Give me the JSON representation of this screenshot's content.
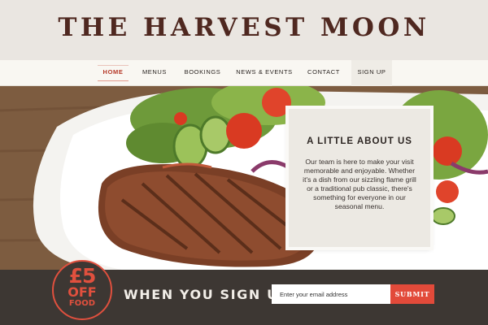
{
  "brand": {
    "name": "THE HARVEST MOON"
  },
  "nav": {
    "items": [
      {
        "label": "HOME",
        "active": true
      },
      {
        "label": "MENUS"
      },
      {
        "label": "BOOKINGS"
      },
      {
        "label": "NEWS & EVENTS"
      },
      {
        "label": "CONTACT"
      },
      {
        "label": "SIGN UP"
      }
    ]
  },
  "about": {
    "title": "A LITTLE ABOUT US",
    "text": "Our team is here to make your visit memorable and enjoyable. Whether it's a dish from our sizzling flame grill or a traditional pub classic, there's something for everyone in our seasonal menu."
  },
  "signup": {
    "badge_amount": "£5",
    "badge_off": "OFF",
    "badge_food": "FOOD",
    "headline": "WHEN YOU SIGN UP",
    "email_placeholder": "Enter your email address",
    "submit_label": "SUBMIT"
  },
  "colors": {
    "brand": "#4f2820",
    "accent": "#e24a3a",
    "bar": "#3d3733"
  }
}
